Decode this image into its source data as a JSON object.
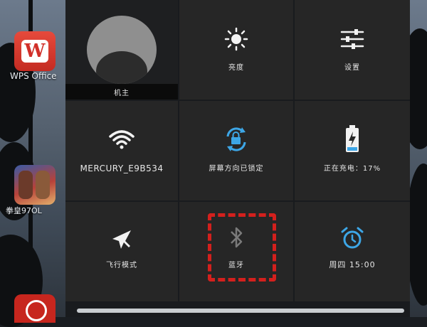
{
  "home": {
    "wps_label": "WPS Office",
    "wps_glyph": "W",
    "game_label": "拳皇97OL",
    "bank_label": ""
  },
  "quick_settings": {
    "owner_label": "机主",
    "brightness_label": "亮度",
    "settings_label": "设置",
    "wifi_label": "MERCURY_E9B534",
    "rotation_label": "屏幕方向已锁定",
    "battery_label": "正在充电：17%",
    "airplane_label": "飞行模式",
    "bluetooth_label": "蓝牙",
    "alarm_label": "周四 15:00",
    "battery_level": 0.17
  },
  "colors": {
    "panel_bg": "#191b1e",
    "tile_bg": "#262626",
    "accent_blue": "#3da6e6",
    "highlight_red": "#d3201d"
  },
  "icons": {
    "brightness": "sun-icon",
    "settings": "sliders-icon",
    "wifi": "wifi-icon",
    "rotation": "rotation-lock-icon",
    "battery": "battery-charging-icon",
    "airplane": "airplane-icon",
    "bluetooth": "bluetooth-icon",
    "alarm": "alarm-clock-icon"
  }
}
